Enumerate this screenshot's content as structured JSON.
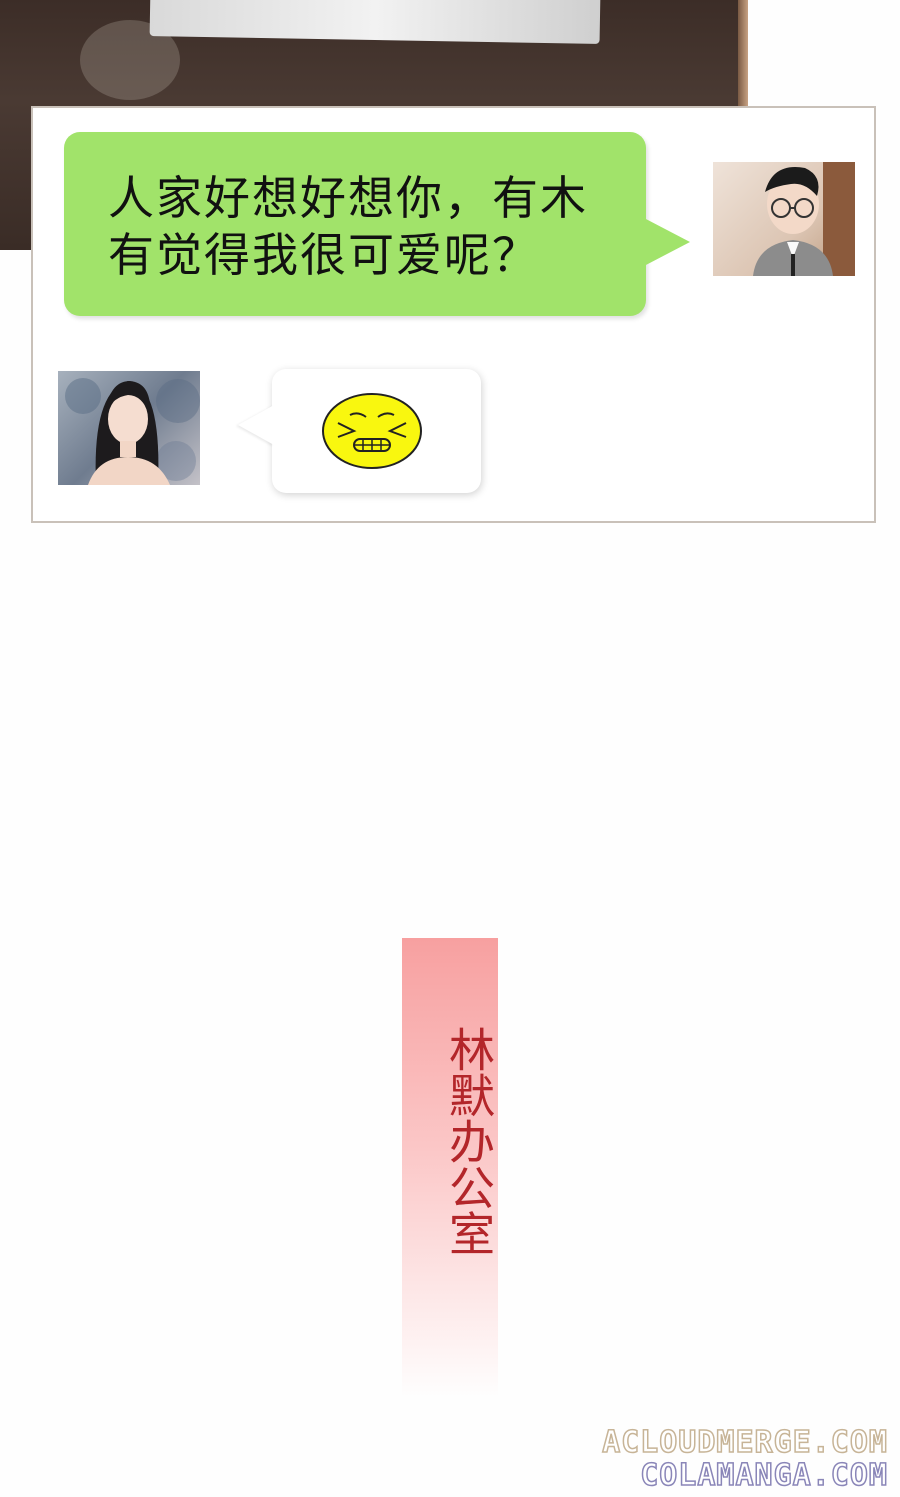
{
  "chat": {
    "outgoing_message": "人家好想好想你，有木有觉得我很可爱呢？",
    "incoming_emoji": "grimace-emoji"
  },
  "scene": {
    "caption": "林默办公室"
  },
  "watermark": {
    "line1": "ACLOUDMERGE.COM",
    "line2": "COLAMANGA.COM"
  },
  "colors": {
    "outgoing_bubble": "#a1e36a",
    "caption_text": "#b3262a",
    "caption_bar": "#f7a0a0",
    "emoji_fill": "#f9f70f"
  }
}
